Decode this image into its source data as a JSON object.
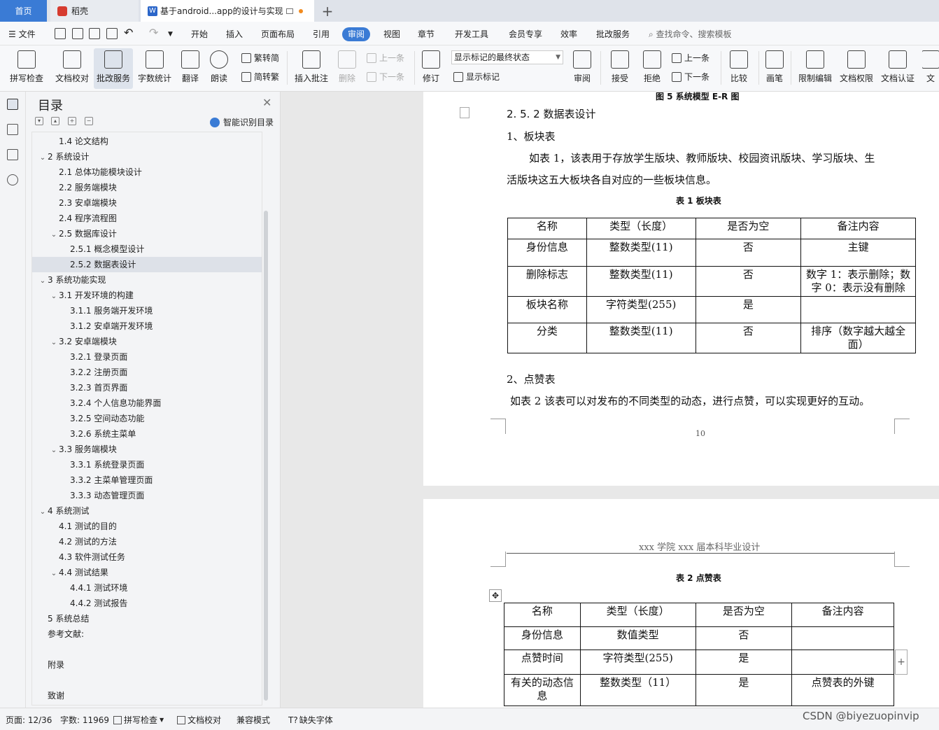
{
  "tabs": {
    "home": "首页",
    "daoke": "稻壳",
    "doc": "基于android...app的设计与实现",
    "add": "+"
  },
  "menu": {
    "file": "文件",
    "items": [
      "开始",
      "插入",
      "页面布局",
      "引用",
      "审阅",
      "视图",
      "章节",
      "开发工具",
      "会员专享",
      "效率",
      "批改服务"
    ],
    "active": "审阅",
    "search": "查找命令、搜索模板"
  },
  "ribbon": {
    "spell": "拼写检查",
    "proof": "文档校对",
    "correct": "批改服务",
    "wordcount": "字数统计",
    "translate": "翻译",
    "read": "朗读",
    "simp_to_trad": "繁转简",
    "trad_to_simp": "简转繁",
    "insert_comment": "插入批注",
    "delete": "删除",
    "prev": "上一条",
    "next": "下一条",
    "revise": "修订",
    "status_select": "显示标记的最终状态",
    "show_marks": "显示标记",
    "review": "审阅",
    "accept": "接受",
    "reject": "拒绝",
    "prev2": "上一条",
    "next2": "下一条",
    "compare": "比较",
    "pen": "画笔",
    "restrict": "限制编辑",
    "doc_rights": "文档权限",
    "doc_auth": "文档认证",
    "doc_more": "文"
  },
  "toc": {
    "title": "目录",
    "smart": "智能识别目录",
    "items": [
      {
        "text": "1.4  论文结构",
        "level": 2,
        "chev": ""
      },
      {
        "text": "2  系统设计",
        "level": 1,
        "chev": "v"
      },
      {
        "text": "2.1  总体功能模块设计",
        "level": 2,
        "chev": ""
      },
      {
        "text": "2.2  服务端模块",
        "level": 2,
        "chev": ""
      },
      {
        "text": "2.3  安卓端模块",
        "level": 2,
        "chev": ""
      },
      {
        "text": "2.4  程序流程图",
        "level": 2,
        "chev": ""
      },
      {
        "text": "2.5  数据库设计",
        "level": 2,
        "chev": "v"
      },
      {
        "text": "2.5.1 概念模型设计",
        "level": 3,
        "chev": ""
      },
      {
        "text": "2.5.2 数据表设计",
        "level": 3,
        "chev": "",
        "selected": true
      },
      {
        "text": "3  系统功能实现",
        "level": 1,
        "chev": "v"
      },
      {
        "text": "3.1 开发环境的构建",
        "level": 2,
        "chev": "v"
      },
      {
        "text": "3.1.1  服务端开发环境",
        "level": 3,
        "chev": ""
      },
      {
        "text": "3.1.2  安卓端开发环境",
        "level": 3,
        "chev": ""
      },
      {
        "text": "3.2  安卓端模块",
        "level": 2,
        "chev": "v"
      },
      {
        "text": "3.2.1  登录页面",
        "level": 3,
        "chev": ""
      },
      {
        "text": "3.2.2  注册页面",
        "level": 3,
        "chev": ""
      },
      {
        "text": "3.2.3  首页界面",
        "level": 3,
        "chev": ""
      },
      {
        "text": "3.2.4  个人信息功能界面",
        "level": 3,
        "chev": ""
      },
      {
        "text": "3.2.5  空间动态功能",
        "level": 3,
        "chev": ""
      },
      {
        "text": "3.2.6  系统主菜单",
        "level": 3,
        "chev": ""
      },
      {
        "text": "3.3  服务端模块",
        "level": 2,
        "chev": "v"
      },
      {
        "text": "3.3.1  系统登录页面",
        "level": 3,
        "chev": ""
      },
      {
        "text": "3.3.2  主菜单管理页面",
        "level": 3,
        "chev": ""
      },
      {
        "text": "3.3.3  动态管理页面",
        "level": 3,
        "chev": ""
      },
      {
        "text": "4  系统测试",
        "level": 1,
        "chev": "v"
      },
      {
        "text": "4.1  测试的目的",
        "level": 2,
        "chev": ""
      },
      {
        "text": "4.2  测试的方法",
        "level": 2,
        "chev": ""
      },
      {
        "text": "4.3  软件测试任务",
        "level": 2,
        "chev": ""
      },
      {
        "text": "4.4  测试结果",
        "level": 2,
        "chev": "v"
      },
      {
        "text": "4.4.1 测试环境",
        "level": 3,
        "chev": ""
      },
      {
        "text": "4.4.2 测试报告",
        "level": 3,
        "chev": ""
      },
      {
        "text": "5  系统总结",
        "level": 1,
        "chev": ""
      },
      {
        "text": "参考文献:",
        "level": 1,
        "chev": ""
      },
      {
        "text": "",
        "level": 1,
        "chev": ""
      },
      {
        "text": "附录",
        "level": 1,
        "chev": ""
      },
      {
        "text": "",
        "level": 1,
        "chev": ""
      },
      {
        "text": "致谢",
        "level": 1,
        "chev": ""
      }
    ]
  },
  "doc": {
    "fig_caption": "图 5 系统模型 E-R 图",
    "heading": "2. 5. 2 数据表设计",
    "sub1": "1、板块表",
    "para1_line1": "如表 1，该表用于存放学生版块、教师版块、校园资讯版块、学习版块、生",
    "para1_line2": "活版块这五大板块各自对应的一些板块信息。",
    "table1_caption": "表 1 板块表",
    "table1": {
      "headers": [
        "名称",
        "类型（长度）",
        "是否为空",
        "备注内容"
      ],
      "rows": [
        [
          "身份信息",
          "整数类型(11)",
          "否",
          "主键"
        ],
        [
          "删除标志",
          "整数类型(11)",
          "否",
          "数字 1：表示删除；数字 0：表示没有删除"
        ],
        [
          "板块名称",
          "字符类型(255)",
          "是",
          ""
        ],
        [
          "分类",
          "整数类型(11)",
          "否",
          "排序（数字越大越全面）"
        ]
      ]
    },
    "sub2": "2、点赞表",
    "para2": "如表 2 该表可以对发布的不同类型的动态，进行点赞，可以实现更好的互动。",
    "page_number": "10",
    "page2_header": "xxx 学院 xxx 届本科毕业设计",
    "table2_caption": "表 2 点赞表",
    "table2": {
      "headers": [
        "名称",
        "类型（长度）",
        "是否为空",
        "备注内容"
      ],
      "rows": [
        [
          "身份信息",
          "数值类型",
          "否",
          ""
        ],
        [
          "点赞时间",
          "字符类型(255)",
          "是",
          ""
        ],
        [
          "有关的动态信息",
          "整数类型（11）",
          "是",
          "点赞表的外键"
        ]
      ]
    }
  },
  "status": {
    "page": "页面: 12/36",
    "words": "字数: 11969",
    "spell": "拼写检查",
    "proof": "文档校对",
    "compat": "兼容模式",
    "missing_font": "缺失字体"
  },
  "watermark": "CSDN @biyezuopinvip"
}
